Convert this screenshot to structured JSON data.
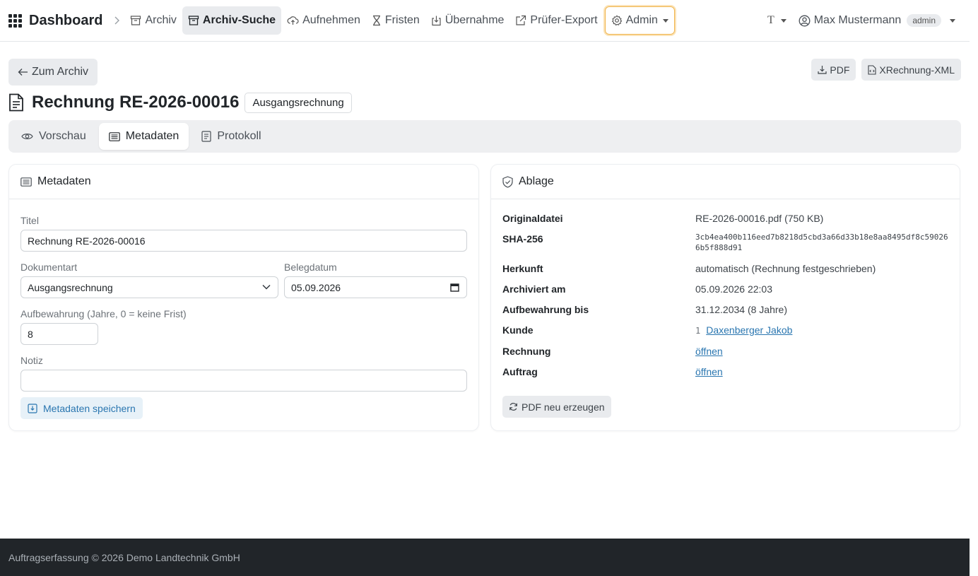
{
  "nav": {
    "brand": "Dashboard",
    "items": [
      {
        "label": "Archiv",
        "icon": "archive-icon"
      },
      {
        "label": "Archiv-Suche",
        "icon": "archive-icon"
      },
      {
        "label": "Aufnehmen",
        "icon": "cloud-upload-icon"
      },
      {
        "label": "Fristen",
        "icon": "hourglass-icon"
      },
      {
        "label": "Übernahme",
        "icon": "download-box-icon"
      },
      {
        "label": "Prüfer-Export",
        "icon": "external-link-icon"
      },
      {
        "label": "Admin",
        "icon": "gear-icon"
      }
    ],
    "theme_label": "T",
    "user_name": "Max Mustermann",
    "user_role": "admin"
  },
  "toolbar": {
    "back_label": "Zum Archiv",
    "pdf_label": "PDF",
    "xml_label": "XRechnung-XML"
  },
  "page": {
    "title": "Rechnung RE-2026-00016",
    "doc_type_badge": "Ausgangsrechnung"
  },
  "tabs": [
    {
      "label": "Vorschau",
      "icon": "eye-icon"
    },
    {
      "label": "Metadaten",
      "icon": "list-icon"
    },
    {
      "label": "Protokoll",
      "icon": "log-icon"
    }
  ],
  "metadata_card": {
    "header": "Metadaten",
    "title_label": "Titel",
    "title_value": "Rechnung RE-2026-00016",
    "doctype_label": "Dokumentart",
    "doctype_value": "Ausgangsrechnung",
    "date_label": "Belegdatum",
    "date_value": "05.09.2026",
    "retention_label": "Aufbewahrung (Jahre, 0 = keine Frist)",
    "retention_value": "8",
    "note_label": "Notiz",
    "note_value": "",
    "save_label": "Metadaten speichern"
  },
  "storage_card": {
    "header": "Ablage",
    "rows": [
      {
        "key": "Originaldatei",
        "value": "RE-2026-00016.pdf (750 KB)"
      },
      {
        "key": "SHA-256",
        "value": "3cb4ea400b116eed7b8218d5cbd3a66d33b18e8aa8495df8c590266b5f888d91"
      },
      {
        "key": "Herkunft",
        "value": "automatisch (Rechnung festgeschrieben)"
      },
      {
        "key": "Archiviert am",
        "value": "05.09.2026 22:03"
      },
      {
        "key": "Aufbewahrung bis",
        "value": "31.12.2034 (8 Jahre)"
      },
      {
        "key": "Kunde",
        "number": "1",
        "value": "Daxenberger Jakob"
      },
      {
        "key": "Rechnung",
        "value": "öffnen"
      },
      {
        "key": "Auftrag",
        "value": "öffnen"
      }
    ],
    "regen_label": "PDF neu erzeugen"
  },
  "footer": {
    "text": "Auftragserfassung © 2026 Demo Landtechnik GmbH"
  },
  "colors": {
    "link": "#2a76b0",
    "admin_outline": "#f0b44c",
    "footer_bg": "#212529"
  }
}
